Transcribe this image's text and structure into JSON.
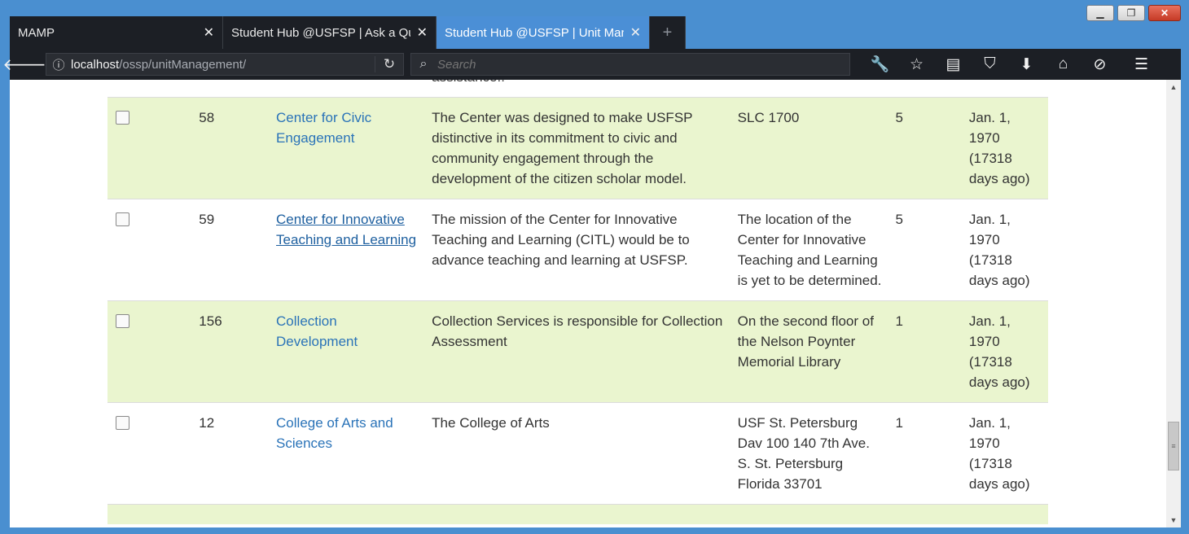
{
  "browser": {
    "tabs": [
      {
        "label": "MAMP",
        "close": "✕"
      },
      {
        "label": "Student Hub @USFSP | Ask a Que",
        "close": "✕"
      },
      {
        "label": "Student Hub @USFSP | Unit Mana",
        "close": "✕"
      }
    ],
    "new_tab": "+",
    "url_host": "localhost",
    "url_path": "/ossp/unitManagement/",
    "search_placeholder": "Search"
  },
  "table": {
    "partial_row_text": "assistance!!",
    "rows": [
      {
        "id": "58",
        "name": "Center for Civic Engagement",
        "description": "The Center was designed to make USFSP distinctive in its commitment to civic and community engagement through the development of the citizen scholar model.",
        "location": "SLC 1700",
        "count": "5",
        "date": "Jan. 1, 1970 (17318 days ago)"
      },
      {
        "id": "59",
        "name": "Center for Innovative Teaching and Learning",
        "description": "The mission of the Center for Innovative Teaching and Learning (CITL) would be to advance teaching and learning at USFSP.",
        "location": "The location of the Center for Innovative Teaching and Learning is yet to be determined.",
        "count": "5",
        "date": "Jan. 1, 1970 (17318 days ago)"
      },
      {
        "id": "156",
        "name": "Collection Development",
        "description": "Collection Services is responsible for Collection Assessment",
        "location": "On the second floor of the Nelson Poynter Memorial Library",
        "count": "1",
        "date": "Jan. 1, 1970 (17318 days ago)"
      },
      {
        "id": "12",
        "name": "College of Arts and Sciences",
        "description": "The College of Arts",
        "location": "USF St. Petersburg Dav 100 140 7th Ave. S. St. Petersburg Florida 33701",
        "count": "1",
        "date": "Jan. 1, 1970 (17318 days ago)"
      }
    ]
  },
  "colors": {
    "row_highlight": "#eaf5cf",
    "link": "#2a73b8",
    "tab_active": "#4b8fd6",
    "chrome_dark": "#1c1f25"
  }
}
